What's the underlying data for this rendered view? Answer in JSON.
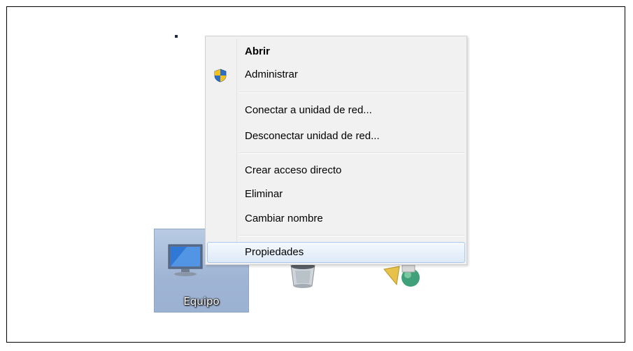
{
  "desktop": {
    "computer_icon": {
      "label": "Equipo",
      "icon": "computer-icon"
    },
    "recycle_bin_icon": {
      "icon": "recycle-bin-icon"
    },
    "network_icon": {
      "icon": "network-icon"
    }
  },
  "context_menu": {
    "items": [
      {
        "label": "Abrir",
        "bold": true
      },
      {
        "label": "Administrar",
        "icon": "uac-shield-icon"
      },
      {
        "label": "Conectar a unidad de red..."
      },
      {
        "label": "Desconectar unidad de red..."
      },
      {
        "label": "Crear acceso directo"
      },
      {
        "label": "Eliminar"
      },
      {
        "label": "Cambiar nombre"
      },
      {
        "label": "Propiedades",
        "highlighted": true
      }
    ]
  },
  "colors": {
    "menu_background": "#f1f1f1",
    "highlight_border": "#aac9ee",
    "selection_background": "#b8cbe3"
  }
}
